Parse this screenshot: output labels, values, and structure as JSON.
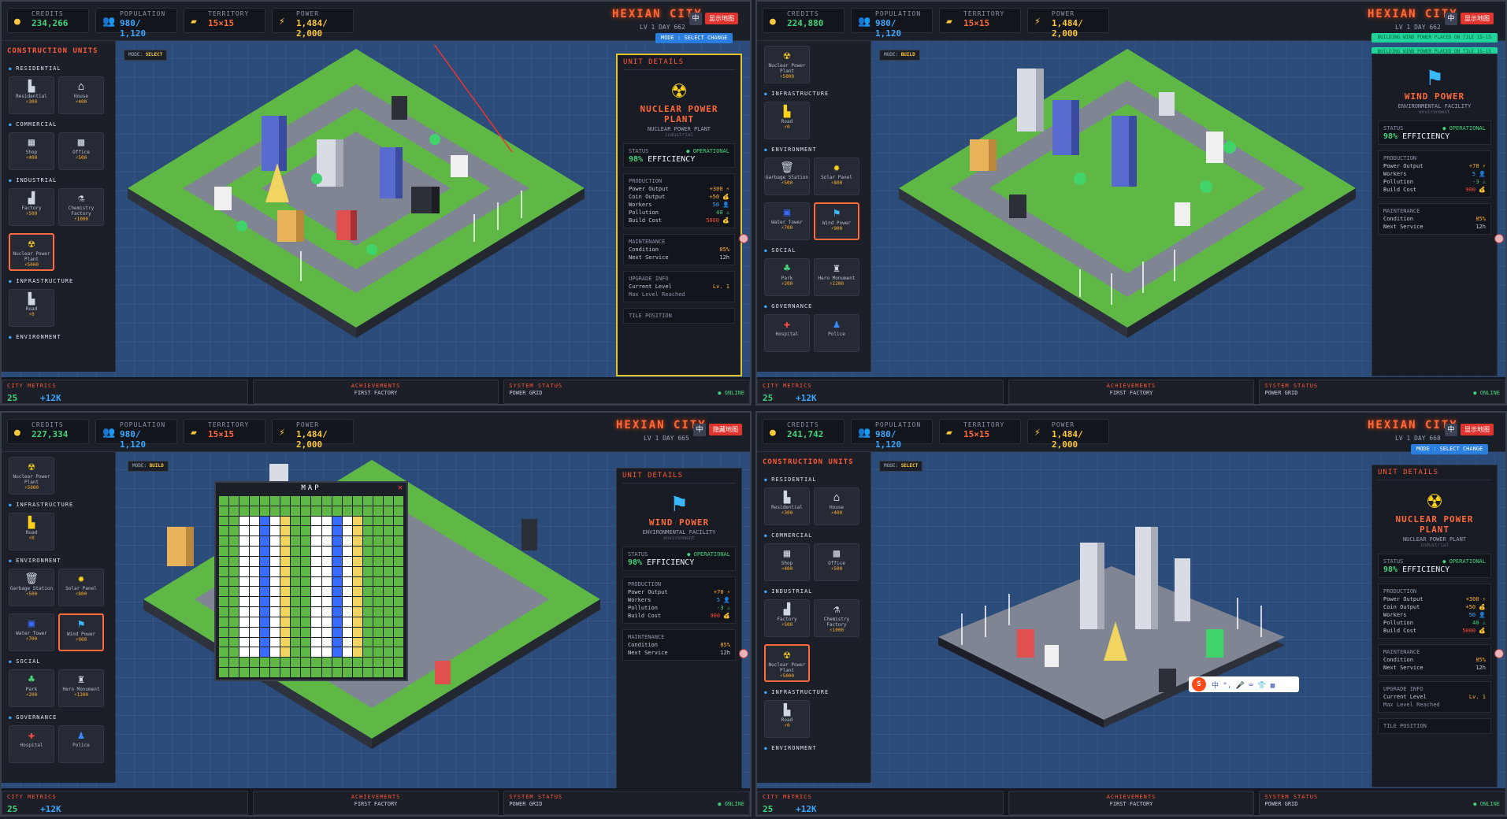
{
  "top_stats": {
    "credits_label": "CREDITS",
    "population_label": "POPULATION",
    "territory_label": "TERRITORY",
    "power_label": "POWER",
    "population": "980/ 1,120",
    "territory": "15×15",
    "power": "1,484/ 2,000"
  },
  "q1": {
    "credits": "234,266",
    "day": "LV 1   DAY 662"
  },
  "q2": {
    "credits": "224,880",
    "day": "LV 1   DAY 662"
  },
  "q3": {
    "credits": "227,334",
    "day": "LV 1   DAY 665"
  },
  "q4": {
    "credits": "241,742",
    "day": "LV 1   DAY 668"
  },
  "header": {
    "title": "HEXIAN CITY",
    "zh_button": "中",
    "show_map": "显示地图",
    "hide_map": "隐藏地图",
    "mode_pill": "MODE : SELECT CHANGE"
  },
  "panel": {
    "title": "CONSTRUCTION UNITS",
    "categories": {
      "residential": "RESIDENTIAL",
      "commercial": "COMMERCIAL",
      "industrial": "INDUSTRIAL",
      "infrastructure": "INFRASTRUCTURE",
      "environment": "ENVIRONMENT",
      "social": "SOCIAL",
      "governance": "GOVERNANCE"
    },
    "units": {
      "residential": {
        "name": "Residential",
        "cost": "⚡300"
      },
      "house": {
        "name": "House",
        "cost": "⚡400"
      },
      "shop": {
        "name": "Shop",
        "cost": "⚡400"
      },
      "office": {
        "name": "Office",
        "cost": "⚡500"
      },
      "factory": {
        "name": "Factory",
        "cost": "⚡500"
      },
      "chem": {
        "name": "Chemistry Factory",
        "cost": "⚡1000"
      },
      "nuclear": {
        "name": "Nuclear Power Plant",
        "cost": "⚡5000"
      },
      "road": {
        "name": "Road",
        "cost": "⚡0"
      },
      "garbage": {
        "name": "Garbage Station",
        "cost": "⚡500"
      },
      "solar": {
        "name": "Solar Panel",
        "cost": "⚡800"
      },
      "water": {
        "name": "Water Tower",
        "cost": "⚡700"
      },
      "wind": {
        "name": "Wind Power",
        "cost": "⚡900"
      },
      "park": {
        "name": "Park",
        "cost": "⚡200"
      },
      "hero": {
        "name": "Hero Monument",
        "cost": "⚡1200"
      },
      "hospital": {
        "name": "Hospital",
        "cost": ""
      },
      "police": {
        "name": "Police",
        "cost": ""
      }
    }
  },
  "mode": {
    "label": "MODE:",
    "select": "SELECT",
    "build": "BUILD"
  },
  "details": {
    "title": "UNIT DETAILS",
    "status_label": "STATUS",
    "status_value": "● OPERATIONAL",
    "efficiency_value": "98%",
    "efficiency_label": "EFFICIENCY",
    "production": "PRODUCTION",
    "power_output": "Power Output",
    "coin_output": "Coin Output",
    "workers": "Workers",
    "pollution": "Pollution",
    "build_cost": "Build Cost",
    "maintenance": "MAINTENANCE",
    "condition": "Condition",
    "condition_value": "85%",
    "next_service": "Next Service",
    "next_service_value": "12h",
    "upgrade": "UPGRADE INFO",
    "current_level": "Current Level",
    "current_level_value": "Lv. 1",
    "max_level": "Max Level Reached",
    "tile_position": "TILE POSITION",
    "nuclear": {
      "name": "NUCLEAR POWER PLANT",
      "type": "NUCLEAR POWER PLANT",
      "category": "industrial",
      "power": "+300 ⚡",
      "coin": "+50 💰",
      "workers": "50 👤",
      "pollution": "40 ⚠",
      "cost": "5000 💰"
    },
    "wind": {
      "name": "WIND POWER",
      "type": "ENVIRONMENTAL FACILITY",
      "category": "environment",
      "power": "+70 ⚡",
      "workers": "5 👤",
      "pollution": "-3 ⚠",
      "cost": "900 💰"
    }
  },
  "bottom": {
    "metrics": "CITY METRICS",
    "metrics_a": "25",
    "metrics_b": "+12K",
    "achievements": "ACHIEVEMENTS",
    "achievement_item": "FIRST FACTORY",
    "system": "SYSTEM STATUS",
    "system_item": "POWER GRID",
    "system_state": "● ONLINE"
  },
  "toasts": [
    "BUILDING WIND POWER PLACED ON TILE 15-15",
    "BUILDING WIND POWER PLACED ON TILE 15-15"
  ],
  "map": {
    "title": "MAP",
    "close": "✕"
  },
  "ime": {
    "logo": "S",
    "items": "中 °, 🎤 ⌨ 👕 ▦"
  },
  "colors": {
    "accent": "#ff6a3a",
    "green": "#46d27a",
    "gold": "#ffb12e",
    "grass": "#5fb845"
  }
}
